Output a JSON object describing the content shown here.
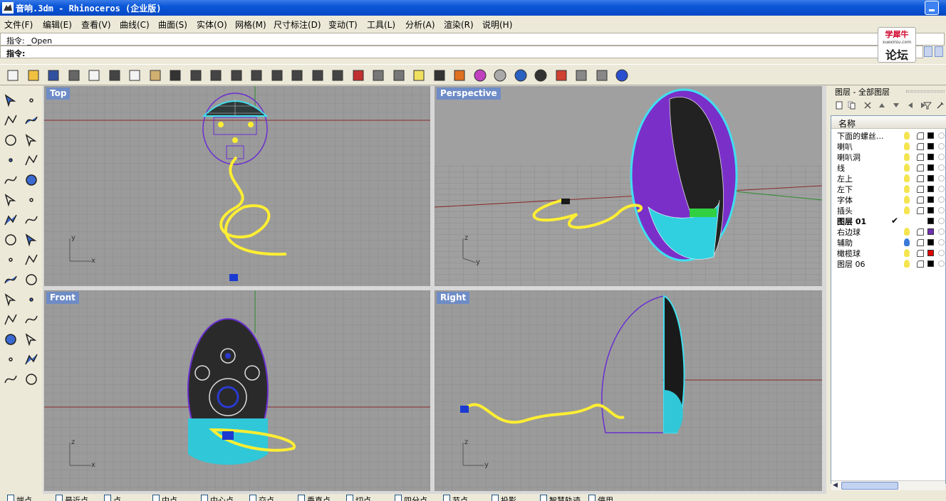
{
  "window": {
    "title": "音响.3dm - Rhinoceros (企业版)"
  },
  "menu": [
    "文件(F)",
    "编辑(E)",
    "查看(V)",
    "曲线(C)",
    "曲面(S)",
    "实体(O)",
    "网格(M)",
    "尺寸标注(D)",
    "变动(T)",
    "工具(L)",
    "分析(A)",
    "渲染(R)",
    "说明(H)"
  ],
  "command": {
    "history": "指令: _Open",
    "prompt": "指令:"
  },
  "logo": {
    "line1": "学犀牛",
    "line2": "xuexiniu.com",
    "line3": "论坛"
  },
  "toolbar_icons": [
    "new-icon",
    "open-icon",
    "save-icon",
    "print-icon",
    "import-icon",
    "cut-icon",
    "copy-icon",
    "paste-icon",
    "undo-icon",
    "pan-icon",
    "rotate-view-icon",
    "zoom-dynamic-icon",
    "zoom-window-icon",
    "zoom-extents-icon",
    "zoom-selected-icon",
    "rotate-icon",
    "four-viewports-icon",
    "car-icon",
    "grid-plane-icon",
    "cplane-icon",
    "light-bulb-icon",
    "lock-icon",
    "layer-icon",
    "color-wheel-icon",
    "wireframe-sphere-icon",
    "render-sphere-icon",
    "shaded-sphere-icon",
    "paint-icon",
    "settings-gear-icon",
    "select-icon",
    "help-icon"
  ],
  "viewports": {
    "top": {
      "label": "Top",
      "axis_x": "x",
      "axis_y": "y"
    },
    "perspective": {
      "label": "Perspective",
      "axis_x": "y",
      "axis_y": "z"
    },
    "front": {
      "label": "Front",
      "axis_x": "x",
      "axis_y": "z"
    },
    "right": {
      "label": "Right",
      "axis_x": "y",
      "axis_y": "z"
    }
  },
  "layer_panel": {
    "title": "图层 - 全部图层",
    "column_name": "名称",
    "layers": [
      {
        "name": "下面的螺丝...",
        "bulb": "on",
        "color": "#000000"
      },
      {
        "name": "喇叭",
        "bulb": "on",
        "color": "#000000"
      },
      {
        "name": "喇叭洞",
        "bulb": "on",
        "color": "#000000"
      },
      {
        "name": "线",
        "bulb": "on",
        "color": "#000000"
      },
      {
        "name": "左上",
        "bulb": "on",
        "color": "#000000"
      },
      {
        "name": "左下",
        "bulb": "on",
        "color": "#000000"
      },
      {
        "name": "字体",
        "bulb": "on",
        "color": "#000000"
      },
      {
        "name": "插头",
        "bulb": "on",
        "color": "#000000"
      },
      {
        "name": "图层 01",
        "current": true,
        "color": "#000000"
      },
      {
        "name": "右边球",
        "bulb": "on",
        "color": "#7030b0"
      },
      {
        "name": "辅助",
        "bulb": "blue",
        "color": "#000000"
      },
      {
        "name": "橄榄球",
        "bulb": "on",
        "color": "#e00000"
      },
      {
        "name": "图层 06",
        "bulb": "on",
        "color": "#000000"
      }
    ]
  },
  "osnaps": [
    "端点",
    "最近点",
    "点",
    "中点",
    "中心点",
    "交点",
    "垂直点",
    "切点",
    "四分点",
    "节点",
    "投影",
    "智慧轨迹",
    "停用"
  ],
  "colors": {
    "viewport_bg": "#9b9b9b",
    "label_bg": "#6e8cc6",
    "accent": "#0a56d8"
  }
}
